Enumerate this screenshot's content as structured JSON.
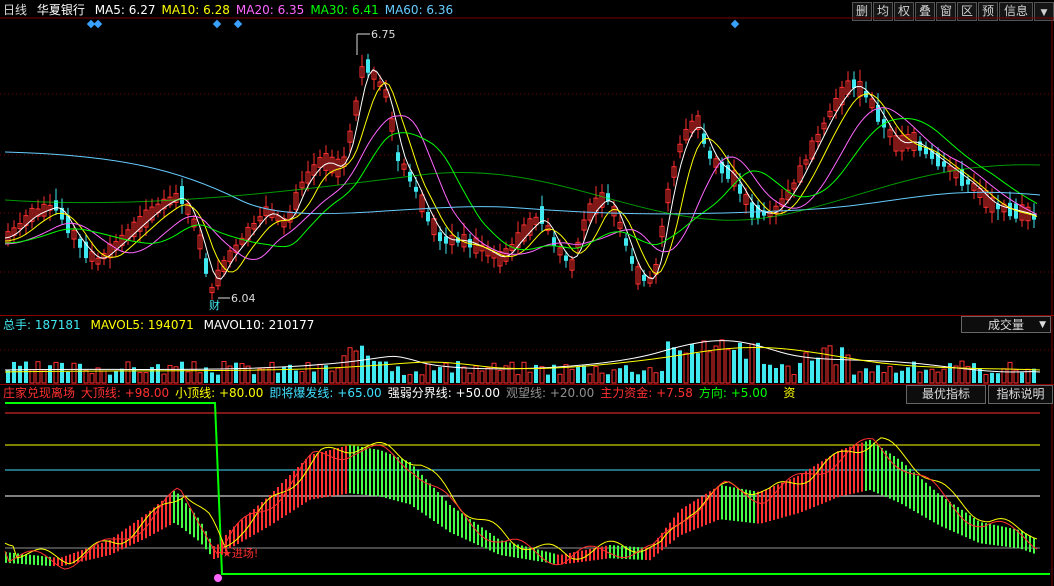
{
  "header": {
    "period": "日线",
    "stock_name": "华夏银行",
    "ma": [
      {
        "label": "MA5: 6.27",
        "color": "#ffffff"
      },
      {
        "label": "MA10: 6.28",
        "color": "#ffff00"
      },
      {
        "label": "MA20: 6.35",
        "color": "#ff66ff"
      },
      {
        "label": "MA30: 6.41",
        "color": "#00ff00"
      },
      {
        "label": "MA60: 6.36",
        "color": "#66ccff"
      }
    ]
  },
  "toolbar": {
    "buttons": [
      "删",
      "均",
      "权",
      "叠",
      "窗",
      "区",
      "预",
      "信息"
    ]
  },
  "price_chart": {
    "high_label": "6.75",
    "low_label": "6.04",
    "event_marker": "财"
  },
  "volume_header": {
    "total_label": "总手: 187181",
    "mavol5_label": "MAVOL5: 194071",
    "mavol10_label": "MAVOL10: 210177",
    "selector_value": "成交量"
  },
  "indicator_header": {
    "name": "庄家兑现离场",
    "items": [
      {
        "label": "大顶线: +98.00",
        "color": "#ff3030"
      },
      {
        "label": "小顶线: +80.00",
        "color": "#ffff00"
      },
      {
        "label": "即将爆发线: +65.00",
        "color": "#40e0ff"
      },
      {
        "label": "强弱分界线: +50.00",
        "color": "#ffffff"
      },
      {
        "label": "观望线: +20.00",
        "color": "#909090"
      },
      {
        "label": "主力资金: +7.58",
        "color": "#ff3030"
      },
      {
        "label": "方向: +5.00",
        "color": "#00ff00"
      }
    ],
    "suffix": "资",
    "best_indicator_button": "最优指标",
    "indicator_help_button": "指标说明"
  },
  "indicator_chart": {
    "entry_label": "★进场!"
  },
  "colors": {
    "up": "#ff3030",
    "down": "#40e8f0",
    "grid": "#7a0000",
    "background": "#000000"
  }
}
